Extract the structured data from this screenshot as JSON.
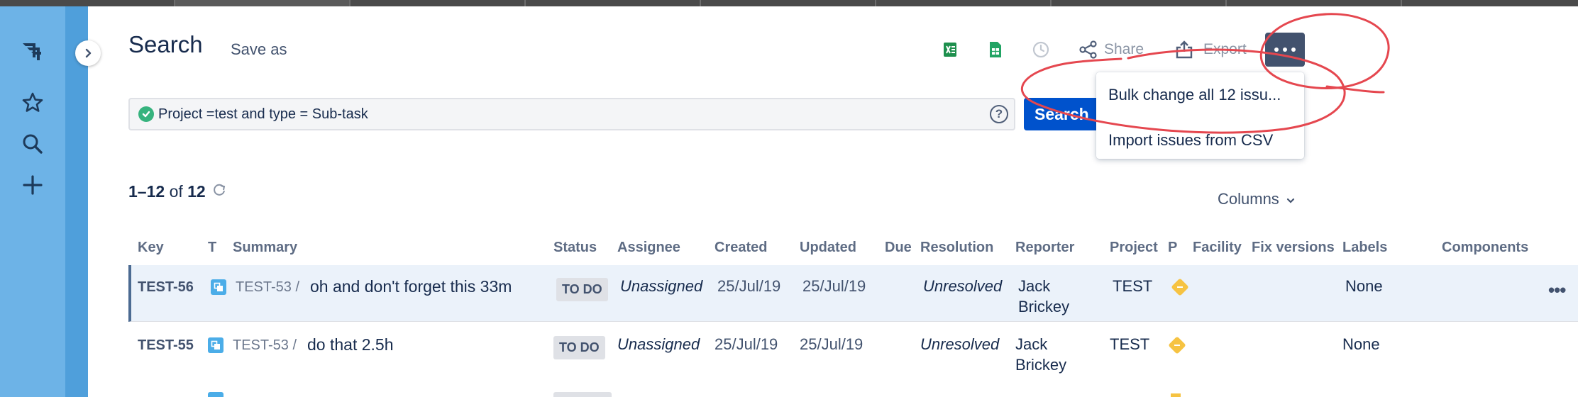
{
  "header": {
    "title": "Search",
    "save_as": "Save as"
  },
  "toolbar": {
    "share_label": "Share",
    "export_label": "Export"
  },
  "query": {
    "value": "Project =test and type = Sub-task",
    "help": "?"
  },
  "search_button": "Search",
  "more_menu": {
    "items": [
      {
        "label": "Bulk change all 12 issu..."
      },
      {
        "label": "Import issues from CSV"
      }
    ]
  },
  "results": {
    "range": "1–12",
    "of": "of",
    "total": "12"
  },
  "columns_button": "Columns",
  "table": {
    "headers": [
      "Key",
      "T",
      "Summary",
      "Status",
      "Assignee",
      "Created",
      "Updated",
      "Due",
      "Resolution",
      "Reporter",
      "Project",
      "P",
      "Facility",
      "Fix versions",
      "Labels",
      "Components"
    ],
    "rows": [
      {
        "key": "TEST-56",
        "parent": "TEST-53 /",
        "summary": "oh and don't forget this 33m",
        "status": "TO DO",
        "assignee": "Unassigned",
        "created": "25/Jul/19",
        "updated": "25/Jul/19",
        "resolution": "Unresolved",
        "reporter_first": "Jack",
        "reporter_last": "Brickey",
        "project": "TEST",
        "labels": "None",
        "selected": true
      },
      {
        "key": "TEST-55",
        "parent": "TEST-53 /",
        "summary": "do that 2.5h",
        "status": "TO DO",
        "assignee": "Unassigned",
        "created": "25/Jul/19",
        "updated": "25/Jul/19",
        "resolution": "Unresolved",
        "reporter_first": "Jack",
        "reporter_last": "Brickey",
        "project": "TEST",
        "labels": "None",
        "selected": false
      }
    ]
  },
  "colors": {
    "rail": "#6db3e7",
    "primary": "#0052cc",
    "annotation": "#e5474f"
  }
}
